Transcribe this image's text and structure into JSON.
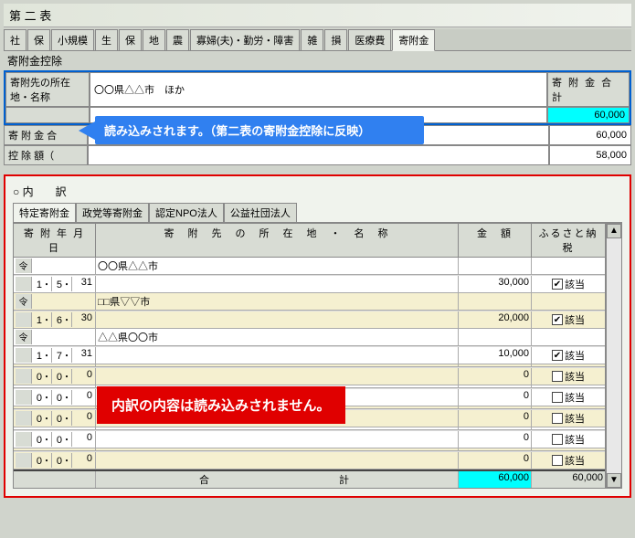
{
  "window_title": "第 二 表",
  "main_tabs": [
    "社",
    "保",
    "小規模",
    "生",
    "保",
    "地",
    "震",
    "寡婦(夫)・勤労・障害",
    "雑",
    "損",
    "医療費",
    "寄附金"
  ],
  "active_main_tab": "寄附金",
  "deduction_section_label": "寄附金控除",
  "donation_addr_label": "寄附先の所在地・名称",
  "donation_addr_value": "〇〇県△△市　ほか",
  "donation_total_label": "寄 附 金 合 計",
  "donation_total_value": "60,000",
  "donation_sum_label_partial": "寄 附 金 合",
  "deduction_amt_label": "控 除 額（",
  "sum_value": "60,000",
  "deduction_value": "58,000",
  "callout_blue": "読み込みされます。（第二表の寄附金控除に反映）",
  "breakdown_title": "○ 内　　訳",
  "sub_tabs": [
    "特定寄附金",
    "政党等寄附金",
    "認定NPO法人",
    "公益社団法人"
  ],
  "table_headers": {
    "date": "寄 附 年 月 日",
    "loc": "寄　附　先　の　所　在　地　・　名　称",
    "amt": "金　額",
    "furusato": "ふるさと納税"
  },
  "gaito_label": "該当",
  "rows": [
    {
      "era": "令",
      "y": "1",
      "m": "5",
      "d": "31",
      "loc": "〇〇県△△市",
      "amt": "30,000",
      "chk": true
    },
    {
      "era": "令",
      "y": "1",
      "m": "6",
      "d": "30",
      "loc": "□□県▽▽市",
      "amt": "20,000",
      "chk": true
    },
    {
      "era": "令",
      "y": "1",
      "m": "7",
      "d": "31",
      "loc": "△△県〇〇市",
      "amt": "10,000",
      "chk": true
    },
    {
      "era": "",
      "y": "0",
      "m": "0",
      "d": "0",
      "loc": "",
      "amt": "0",
      "chk": false
    },
    {
      "era": "",
      "y": "0",
      "m": "0",
      "d": "0",
      "loc": "",
      "amt": "0",
      "chk": false
    },
    {
      "era": "",
      "y": "0",
      "m": "0",
      "d": "0",
      "loc": "",
      "amt": "0",
      "chk": false
    },
    {
      "era": "",
      "y": "0",
      "m": "0",
      "d": "0",
      "loc": "",
      "amt": "0",
      "chk": false
    },
    {
      "era": "",
      "y": "0",
      "m": "0",
      "d": "0",
      "loc": "",
      "amt": "0",
      "chk": false
    }
  ],
  "total_label": "合　　　　　　　　計",
  "total_amt": "60,000",
  "total_furusato": "60,000",
  "callout_red": "内訳の内容は読み込みされません。"
}
